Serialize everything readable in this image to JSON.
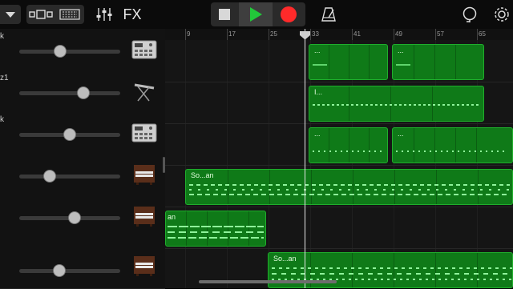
{
  "toolbar": {
    "fx_label": "FX"
  },
  "ruler": {
    "bars": [
      "9",
      "17",
      "25",
      "33",
      "41",
      "49",
      "57",
      "65"
    ]
  },
  "tracks": [
    {
      "name": "k",
      "volume": 0.41,
      "instrument": "drum-machine-icon"
    },
    {
      "name": "z1",
      "volume": 0.64,
      "instrument": "keyboard-stand-icon"
    },
    {
      "name": "k",
      "volume": 0.5,
      "instrument": "drum-machine-icon"
    },
    {
      "name": "",
      "volume": 0.3,
      "instrument": "organ-icon"
    },
    {
      "name": "",
      "volume": 0.55,
      "instrument": "organ-icon"
    },
    {
      "name": "",
      "volume": 0.4,
      "instrument": "organ-icon"
    }
  ],
  "regions": [
    {
      "track": 0,
      "label": "..."
    },
    {
      "track": 0,
      "label": "..."
    },
    {
      "track": 1,
      "label": "I..."
    },
    {
      "track": 2,
      "label": "..."
    },
    {
      "track": 2,
      "label": "..."
    },
    {
      "track": 3,
      "label": "So...an"
    },
    {
      "track": 4,
      "label": "an"
    },
    {
      "track": 5,
      "label": "So...an"
    }
  ],
  "colors": {
    "region_fill": "#0f7a18",
    "region_border": "#1fae2c",
    "play_green": "#22c83a",
    "record_red": "#ff2a2a"
  }
}
